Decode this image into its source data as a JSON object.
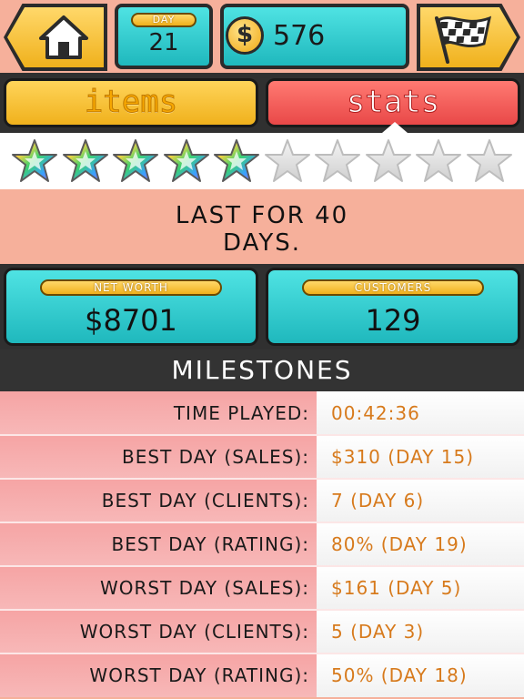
{
  "topbar": {
    "day_label": "DAY",
    "day_value": "21",
    "money_symbol": "$",
    "money_value": "576"
  },
  "tabs": [
    {
      "label": "items",
      "active": false
    },
    {
      "label": "stats",
      "active": true
    }
  ],
  "rating": {
    "filled": 5,
    "total": 10
  },
  "message": {
    "line1": "LAST FOR 40",
    "line2": "DAYS."
  },
  "cards": {
    "net_worth_label": "NET WORTH",
    "net_worth_value": "$8701",
    "customers_label": "CUSTOMERS",
    "customers_value": "129"
  },
  "milestones": {
    "title": "MILESTONES",
    "rows": [
      {
        "label": "TIME PLAYED:",
        "value": "00:42:36"
      },
      {
        "label": "BEST DAY (SALES):",
        "value": "$310 (DAY 15)"
      },
      {
        "label": "BEST DAY (CLIENTS):",
        "value": "7 (DAY 6)"
      },
      {
        "label": "BEST DAY (RATING):",
        "value": "80% (DAY 19)"
      },
      {
        "label": "WORST DAY (SALES):",
        "value": "$161 (DAY 5)"
      },
      {
        "label": "WORST DAY (CLIENTS):",
        "value": "5 (DAY 3)"
      },
      {
        "label": "WORST DAY (RATING):",
        "value": "50% (DAY 18)"
      }
    ]
  },
  "colors": {
    "accent_teal": "#1fb8bd",
    "accent_yellow": "#f0b11c",
    "accent_red": "#e94848",
    "background_salmon": "#f6b09b",
    "milestone_value": "#d77a1c"
  },
  "icons": [
    "home-icon",
    "dollar-coin-icon",
    "checkered-flag-icon",
    "rainbow-star-icon",
    "empty-star-icon"
  ]
}
